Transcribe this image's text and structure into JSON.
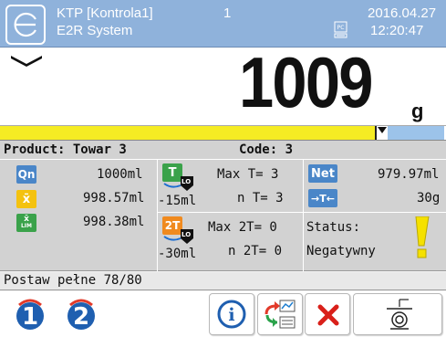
{
  "header": {
    "title_line1": "KTP [Kontrola1]",
    "title_line2": "E2R System",
    "platform_number": "1",
    "pc_icon_text": "PC",
    "date": "2016.04.27",
    "time": "12:20:47"
  },
  "weight": {
    "value": "1009",
    "unit": "g"
  },
  "bargraph": {
    "fill_fraction": 0.845
  },
  "info": {
    "product_label": "Product: Towar 3",
    "code_label": "Code: 3",
    "qn_icon": "Qn",
    "qn_value": "1000ml",
    "xbar_icon": "x̄",
    "xbar_value": "998.57ml",
    "lim_icon_top": "x̄",
    "lim_icon_bottom": "LIM",
    "lim_value": "998.38ml",
    "t_icon": "T",
    "t_limit": "-15ml",
    "max_t": "Max T= 3",
    "n_t": "n T= 3",
    "t2_icon": "2T",
    "t2_limit": "-30ml",
    "max_2t": "Max 2T= 0",
    "n_2t": "n 2T= 0",
    "net_label": "Net",
    "net_value": "979.97ml",
    "tare_label": "→T←",
    "tare_value": "30g",
    "status_label": "Status:",
    "status_value": "Negatywny",
    "lo_badge": "LO"
  },
  "message": "Postaw pełne 78/80",
  "buttons": {
    "one_label": "1",
    "two_label": "2",
    "info_label": "i"
  },
  "colors": {
    "header_bg": "#8fb2db",
    "bar_yellow": "#f5ec23",
    "bar_blue": "#9cc3ea",
    "icon_blue": "#4a86c8",
    "icon_green": "#3aa24a",
    "icon_orange": "#f08a1e",
    "icon_yellow": "#f4c20f",
    "status_yellow": "#f5e100",
    "cancel_red": "#d9201a"
  }
}
